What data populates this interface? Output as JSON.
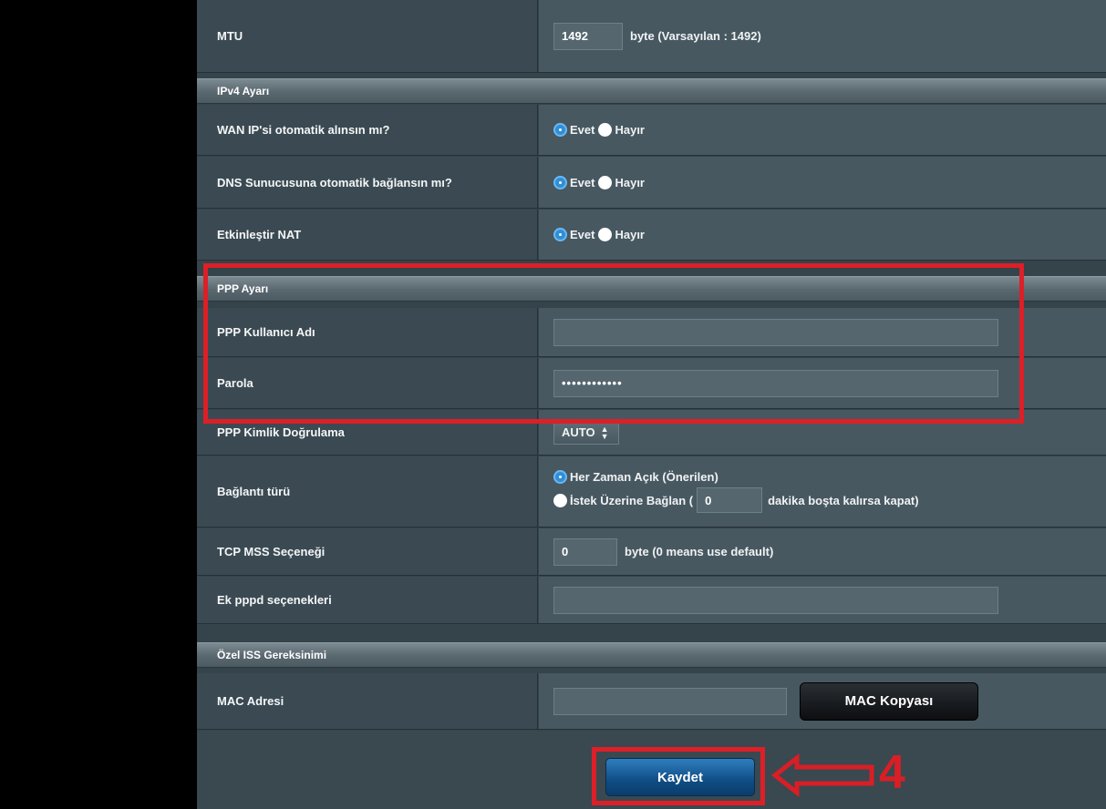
{
  "mtu": {
    "label": "MTU",
    "value": "1492",
    "unit": "byte (Varsayılan : 1492)"
  },
  "ipv4": {
    "title": "IPv4 Ayarı",
    "rows": [
      {
        "label": "WAN IP'si otomatik alınsın mı?",
        "yes": "Evet",
        "no": "Hayır",
        "selected": "Evet"
      },
      {
        "label": "DNS Sunucusuna otomatik bağlansın mı?",
        "yes": "Evet",
        "no": "Hayır",
        "selected": "Evet"
      },
      {
        "label": "Etkinleştir NAT",
        "yes": "Evet",
        "no": "Hayır",
        "selected": "Evet"
      }
    ]
  },
  "ppp": {
    "title": "PPP Ayarı",
    "username_label": "PPP Kullanıcı Adı",
    "username_value": "",
    "password_label": "Parola",
    "password_value": "••••••••••••",
    "auth_label": "PPP Kimlik Doğrulama",
    "auth_value": "AUTO",
    "conn_label": "Bağlantı türü",
    "conn_always": "Her Zaman Açık (Önerilen)",
    "conn_ondemand_pre": "İstek Üzerine Bağlan (",
    "conn_ondemand_value": "0",
    "conn_ondemand_post": "dakika boşta kalırsa kapat)",
    "conn_selected": "Her Zaman Açık (Önerilen)",
    "mss_label": "TCP MSS Seçeneği",
    "mss_value": "0",
    "mss_unit": "byte (0 means use default)",
    "pppd_label": "Ek pppd seçenekleri",
    "pppd_value": ""
  },
  "isp": {
    "title": "Özel ISS Gereksinimi",
    "mac_label": "MAC Adresi",
    "mac_value": "",
    "mac_clone_label": "MAC Kopyası"
  },
  "save_label": "Kaydet",
  "annotation_number": "4",
  "colors": {
    "highlight": "#dd1f27",
    "radio_on": "#2f8fd6",
    "save_button": "#1a5d9c"
  }
}
